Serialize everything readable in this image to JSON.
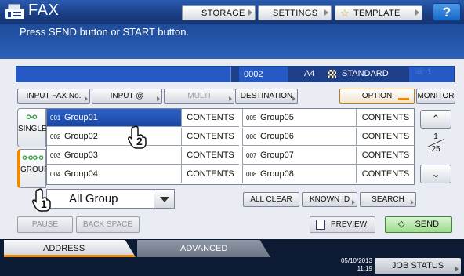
{
  "header": {
    "title": "FAX",
    "storage_label": "STORAGE",
    "settings_label": "SETTINGS",
    "template_label": "TEMPLATE",
    "help_label": "?"
  },
  "message": "Press SEND button or START button.",
  "status": {
    "count": "0002",
    "paper": "A4",
    "resolution": "STANDARD",
    "line": "1"
  },
  "input_row": {
    "input_fax_no": "INPUT FAX No.",
    "input_at": "INPUT @",
    "multi": "MULTI",
    "destination": "DESTINATION",
    "option": "OPTION",
    "monitor": "MONITOR"
  },
  "side_tabs": {
    "single": "SINGLE",
    "group": "GROUP"
  },
  "groups": [
    {
      "num": "001",
      "name": "Group01",
      "contents": "CONTENTS"
    },
    {
      "num": "002",
      "name": "Group02",
      "contents": "CONTENTS"
    },
    {
      "num": "003",
      "name": "Group03",
      "contents": "CONTENTS"
    },
    {
      "num": "004",
      "name": "Group04",
      "contents": "CONTENTS"
    },
    {
      "num": "005",
      "name": "Group05",
      "contents": "CONTENTS"
    },
    {
      "num": "006",
      "name": "Group06",
      "contents": "CONTENTS"
    },
    {
      "num": "007",
      "name": "Group07",
      "contents": "CONTENTS"
    },
    {
      "num": "008",
      "name": "Group08",
      "contents": "CONTENTS"
    }
  ],
  "pager": {
    "current": "1",
    "total": "25"
  },
  "group_select": "All Group",
  "list_buttons": {
    "all_clear": "ALL CLEAR",
    "known_id": "KNOWN ID",
    "search": "SEARCH"
  },
  "bottom_buttons": {
    "pause": "PAUSE",
    "back_space": "BACK SPACE",
    "preview": "PREVIEW",
    "send": "SEND"
  },
  "tabs": {
    "address": "ADDRESS",
    "advanced": "ADVANCED"
  },
  "datetime": {
    "date": "05/10/2013",
    "time": "11:19"
  },
  "job_status": "JOB STATUS",
  "callouts": {
    "one": "1",
    "two": "2"
  },
  "colors": {
    "accent": "#f08a00",
    "selected": "#1f4fb3",
    "send": "#9ed98d"
  }
}
